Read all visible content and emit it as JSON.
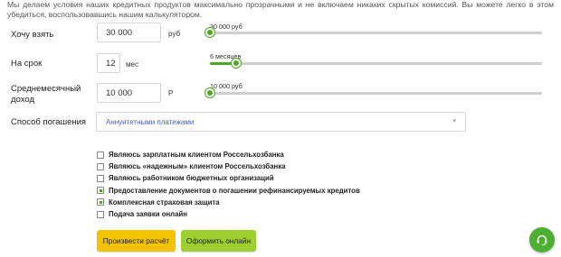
{
  "intro_text": "Мы делаем условия наших кредитных продуктов максимально прозрачными и не включаем никаких скрытых комиссий. Вы можете легко в этом убедиться, воспользовавшись нашим калькулятором.",
  "amount": {
    "label": "Хочу взять",
    "value": "30 000",
    "unit": "руб",
    "slider_value": "30 000 руб",
    "slider_fraction": 0.0
  },
  "term": {
    "label": "На срок",
    "value": "12",
    "unit": "мес",
    "slider_value": "6 месяцев",
    "slider_fraction": 0.08
  },
  "income": {
    "label_line1": "Среднемесячный",
    "label_line2": "доход",
    "value": "10 000",
    "unit": "Р",
    "slider_value": "10 000 руб",
    "slider_fraction": 0.0
  },
  "repayment": {
    "label": "Способ погашения",
    "selected": "Аннуитетными платежами"
  },
  "checkboxes": [
    {
      "label": "Являюсь зарплатным клиентом Россельхозбанка",
      "checked": false
    },
    {
      "label": "Являюсь «надежным» клиентом Россельхозбанка",
      "checked": false
    },
    {
      "label": "Являюсь работником бюджетных организаций",
      "checked": false
    },
    {
      "label": "Предоставление документов о погашении рефинансируемых кредитов",
      "checked": true
    },
    {
      "label": "Комплексная страховая защита",
      "checked": true
    },
    {
      "label": "Подача заявки онлайн",
      "checked": false
    }
  ],
  "buttons": {
    "calculate": "Произвести расчёт",
    "apply_online": "Оформить онлайн"
  },
  "colors": {
    "accent_green": "#4ea624",
    "button_yellow": "#f3c300",
    "button_green": "#9fce30",
    "chat_green": "#4caf32"
  },
  "icons": {
    "chat": "headset-chat-icon",
    "select_arrow": "chevron-down-icon"
  }
}
